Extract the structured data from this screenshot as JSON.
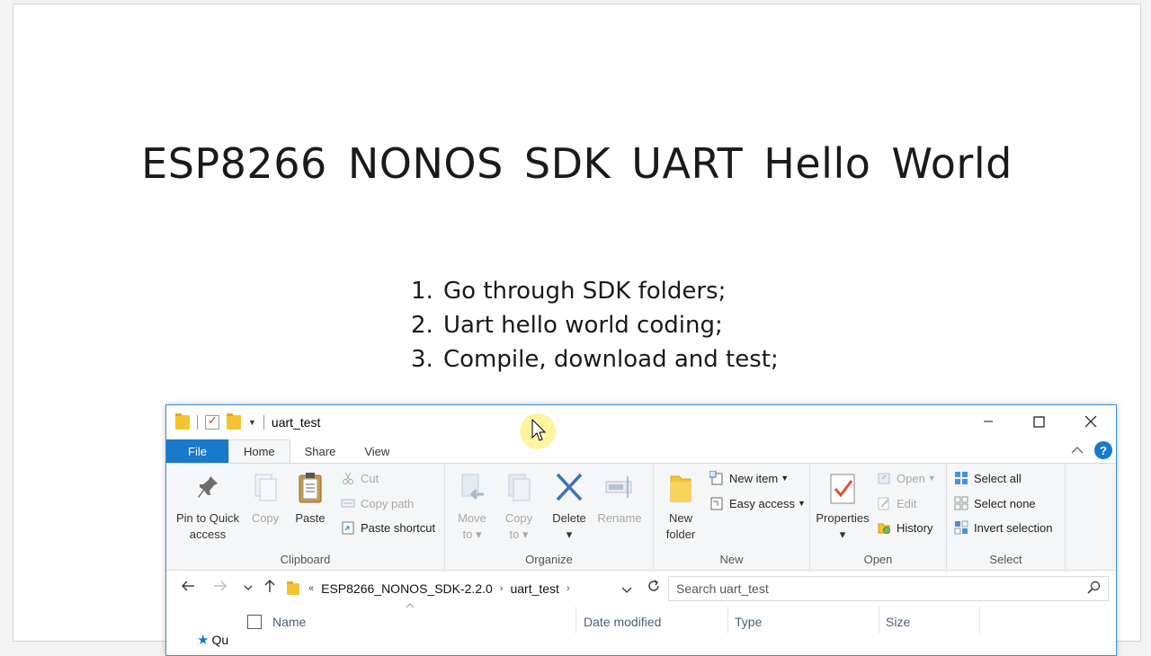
{
  "slide": {
    "title": "ESP8266  NONOS  SDK  UART  Hello  World",
    "items": [
      {
        "num": "1.",
        "text": "Go through SDK folders;"
      },
      {
        "num": "2.",
        "text": "Uart hello world coding;"
      },
      {
        "num": "3.",
        "text": "Compile, download and test;"
      }
    ]
  },
  "explorer": {
    "title": "uart_test",
    "window_controls": {
      "minimize": "—",
      "maximize": "☐",
      "close": "✕"
    },
    "tabs": {
      "file": "File",
      "home": "Home",
      "share": "Share",
      "view": "View"
    },
    "help": "?",
    "ribbon": {
      "clipboard": {
        "label": "Clipboard",
        "pin": "Pin to Quick access",
        "pin_l1": "Pin to Quick",
        "pin_l2": "access",
        "copy": "Copy",
        "paste": "Paste",
        "cut": "Cut",
        "copy_path": "Copy path",
        "paste_shortcut": "Paste shortcut"
      },
      "organize": {
        "label": "Organize",
        "move_l1": "Move",
        "move_l2": "to",
        "copy_l1": "Copy",
        "copy_l2": "to",
        "delete": "Delete",
        "rename": "Rename"
      },
      "new": {
        "label": "New",
        "folder_l1": "New",
        "folder_l2": "folder",
        "new_item": "New item",
        "easy_access": "Easy access"
      },
      "open": {
        "label": "Open",
        "properties": "Properties",
        "open": "Open",
        "edit": "Edit",
        "history": "History"
      },
      "select": {
        "label": "Select",
        "select_all": "Select all",
        "select_none": "Select none",
        "invert": "Invert selection"
      }
    },
    "address": {
      "crumbs": [
        "ESP8266_NONOS_SDK-2.2.0",
        "uart_test"
      ],
      "search_placeholder": "Search uart_test"
    },
    "columns": {
      "name": "Name",
      "date": "Date modified",
      "type": "Type",
      "size": "Size"
    },
    "navpane": {
      "first": "Qu"
    }
  },
  "colors": {
    "accent": "#1979ca",
    "ribbon_bg": "#f5f6f7",
    "border_active": "#3a8fd9"
  }
}
